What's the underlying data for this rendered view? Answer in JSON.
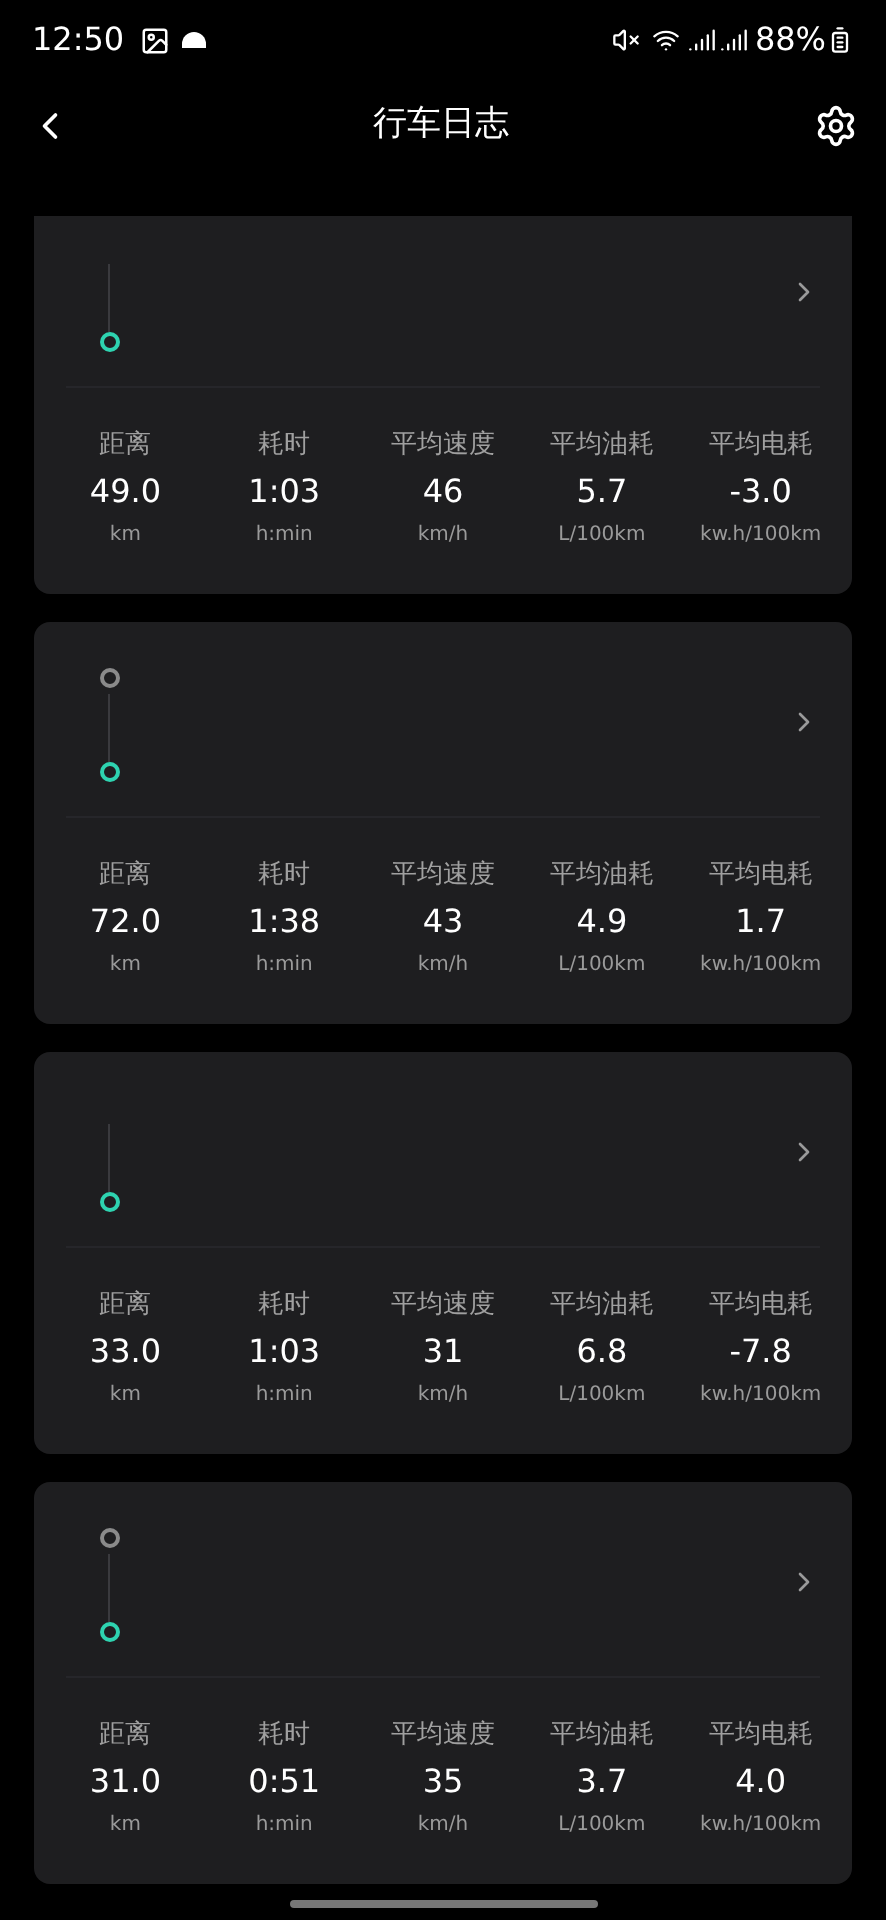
{
  "status_bar": {
    "time": "12:50",
    "battery": "88%"
  },
  "header": {
    "title": "行车日志"
  },
  "trips": [
    {
      "origin_marker": false,
      "stats": [
        {
          "label": "距离",
          "value": "49.0",
          "unit": "km"
        },
        {
          "label": "耗时",
          "value": "1:03",
          "unit": "h:min"
        },
        {
          "label": "平均速度",
          "value": "46",
          "unit": "km/h"
        },
        {
          "label": "平均油耗",
          "value": "5.7",
          "unit": "L/100km"
        },
        {
          "label": "平均电耗",
          "value": "-3.0",
          "unit": "kw.h/100km"
        }
      ]
    },
    {
      "origin_marker": true,
      "stats": [
        {
          "label": "距离",
          "value": "72.0",
          "unit": "km"
        },
        {
          "label": "耗时",
          "value": "1:38",
          "unit": "h:min"
        },
        {
          "label": "平均速度",
          "value": "43",
          "unit": "km/h"
        },
        {
          "label": "平均油耗",
          "value": "4.9",
          "unit": "L/100km"
        },
        {
          "label": "平均电耗",
          "value": "1.7",
          "unit": "kw.h/100km"
        }
      ]
    },
    {
      "origin_marker": false,
      "stats": [
        {
          "label": "距离",
          "value": "33.0",
          "unit": "km"
        },
        {
          "label": "耗时",
          "value": "1:03",
          "unit": "h:min"
        },
        {
          "label": "平均速度",
          "value": "31",
          "unit": "km/h"
        },
        {
          "label": "平均油耗",
          "value": "6.8",
          "unit": "L/100km"
        },
        {
          "label": "平均电耗",
          "value": "-7.8",
          "unit": "kw.h/100km"
        }
      ]
    },
    {
      "origin_marker": true,
      "stats": [
        {
          "label": "距离",
          "value": "31.0",
          "unit": "km"
        },
        {
          "label": "耗时",
          "value": "0:51",
          "unit": "h:min"
        },
        {
          "label": "平均速度",
          "value": "35",
          "unit": "km/h"
        },
        {
          "label": "平均油耗",
          "value": "3.7",
          "unit": "L/100km"
        },
        {
          "label": "平均电耗",
          "value": "4.0",
          "unit": "kw.h/100km"
        }
      ]
    }
  ]
}
